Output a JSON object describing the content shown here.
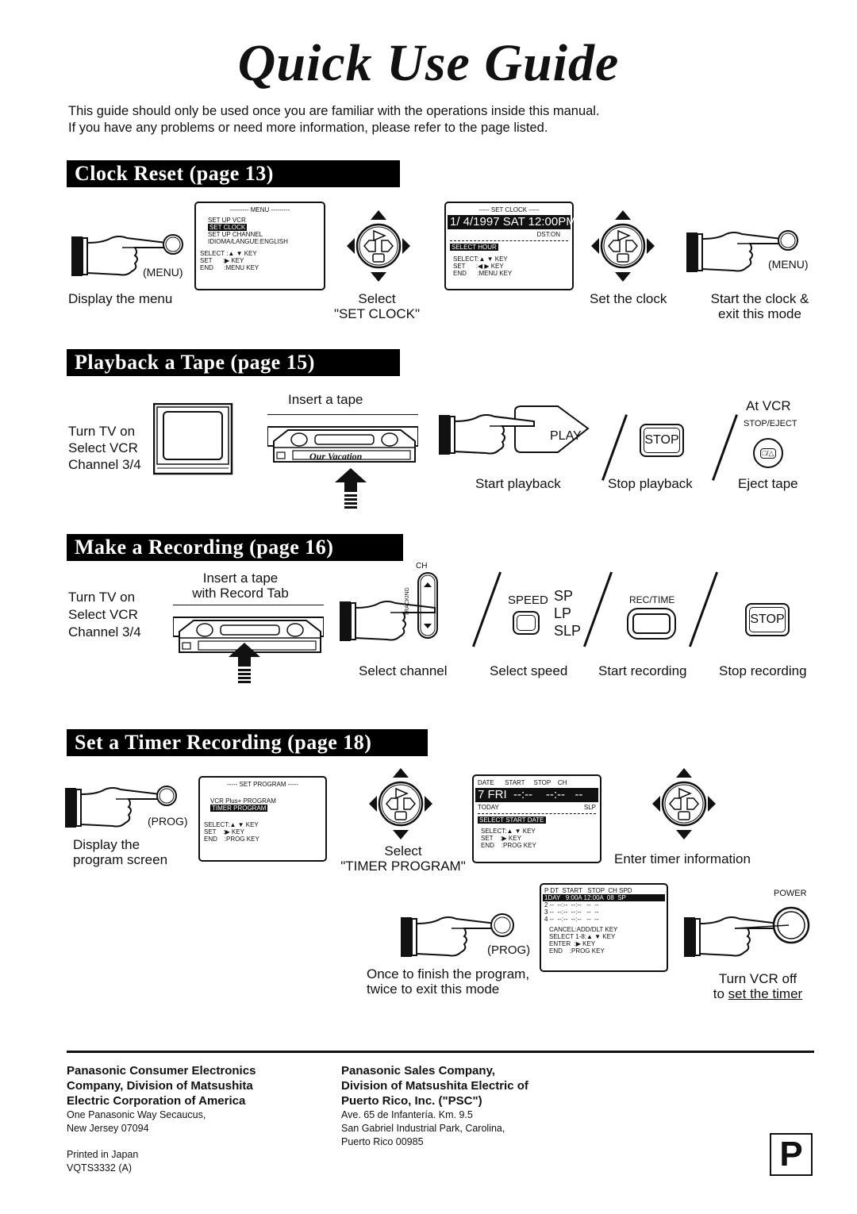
{
  "title": "Quick Use Guide",
  "intro": [
    "This guide should only be used once you are familiar with the operations inside this manual.",
    "If you have any problems or need more information, please refer to the page listed."
  ],
  "sections": {
    "clock": {
      "heading": "Clock Reset (page 13)",
      "menu_button": "(MENU)",
      "step1": "Display the menu",
      "osd_menu": {
        "header": "--------- MENU ---------",
        "items": [
          "SET UP VCR",
          "SET CLOCK",
          "SET UP CHANNEL",
          "IDIOMA/LANGUE:ENGLISH"
        ],
        "selected": "SET CLOCK",
        "keys": [
          "SELECT :▲ ▼ KEY",
          "SET      :▶ KEY",
          "END      :MENU KEY"
        ]
      },
      "step2": [
        "Select",
        "\"SET CLOCK\""
      ],
      "osd_clock": {
        "header": "----- SET CLOCK -----",
        "datetime": "1/ 4/1997 SAT 12:00PM",
        "dst": "DST:ON",
        "status": "SELECT HOUR",
        "keys": [
          "SELECT:▲ ▼ KEY",
          "SET      :◀ ▶ KEY",
          "END      :MENU KEY"
        ]
      },
      "step3": "Set the clock",
      "menu_button2": "(MENU)",
      "step4": [
        "Start the clock &",
        "exit this mode"
      ]
    },
    "playback": {
      "heading": "Playback a Tape (page 15)",
      "tv_text": [
        "Turn TV on",
        "Select VCR",
        "Channel 3/4"
      ],
      "insert": "Insert a tape",
      "tape_label": "Our Vacation",
      "play_label": "PLAY",
      "stop_label": "STOP",
      "at_vcr": "At VCR",
      "stop_eject": "STOP/EJECT",
      "eject_glyph": "□/△",
      "captions": [
        "Start playback",
        "Stop playback",
        "Eject tape"
      ]
    },
    "recording": {
      "heading": "Make a Recording (page 16)",
      "tv_text": [
        "Turn TV on",
        "Select VCR",
        "Channel 3/4"
      ],
      "insert": [
        "Insert a tape",
        "with Record Tab"
      ],
      "ch_label": "CH",
      "tracking_label": "TRACKING",
      "speed_label": "SPEED",
      "speeds": [
        "SP",
        "LP",
        "SLP"
      ],
      "rec_label": "REC/TIME",
      "stop_label": "STOP",
      "captions": [
        "Select channel",
        "Select speed",
        "Start recording",
        "Stop recording"
      ]
    },
    "timer": {
      "heading": "Set a Timer Recording (page 18)",
      "prog_button": "(PROG)",
      "step1": [
        "Display the",
        "program screen"
      ],
      "osd_program": {
        "header": "----- SET PROGRAM -----",
        "items": [
          "VCR Plus+ PROGRAM",
          "TIMER PROGRAM"
        ],
        "selected": "TIMER PROGRAM",
        "keys": [
          "SELECT:▲ ▼ KEY",
          "SET    :▶ KEY",
          "END    :PROG KEY"
        ]
      },
      "step2": [
        "Select",
        "\"TIMER PROGRAM\""
      ],
      "osd_date": {
        "header": "DATE      START     STOP    CH",
        "row": "7 FRI  --:--    --:--   --",
        "sub_left": "TODAY",
        "sub_right": "SLP",
        "status": "SELECT START DATE",
        "keys": [
          "SELECT:▲ ▼ KEY",
          "SET    :▶ KEY",
          "END    :PROG KEY"
        ]
      },
      "step3": "Enter timer information",
      "osd_list": {
        "header": "P DT  START   STOP  CH SPD",
        "rows": [
          "1DAY   9:00A 12:00A  08  SP",
          "2 --  --:--  --:--   --  --",
          "3 --  --:--  --:--   --  --",
          "4 --  --:--  --:--   --  --"
        ],
        "keys": [
          "CANCEL:ADD/DLT KEY",
          "SELECT 1-8:▲ ▼ KEY",
          "ENTER  :▶ KEY",
          "END    :PROG KEY"
        ]
      },
      "prog_button2": "(PROG)",
      "step4": [
        "Once to finish the program,",
        "twice to exit this mode"
      ],
      "power_label": "POWER",
      "step5": [
        "Turn VCR off",
        "to ",
        "set the timer"
      ]
    }
  },
  "footer": {
    "left_bold": [
      "Panasonic Consumer Electronics",
      "Company, Division of Matsushita",
      "Electric Corporation of America"
    ],
    "left_addr": [
      "One Panasonic Way Secaucus,",
      "New Jersey 07094"
    ],
    "printed": [
      "Printed in Japan",
      "VQTS3332  (A)"
    ],
    "right_bold": [
      "Panasonic Sales Company,",
      "Division of Matsushita Electric of",
      "Puerto Rico, Inc. (\"PSC\")"
    ],
    "right_addr": [
      "Ave. 65 de Infantería. Km. 9.5",
      "San Gabriel Industrial Park, Carolina,",
      "Puerto Rico 00985"
    ],
    "badge": "P"
  }
}
